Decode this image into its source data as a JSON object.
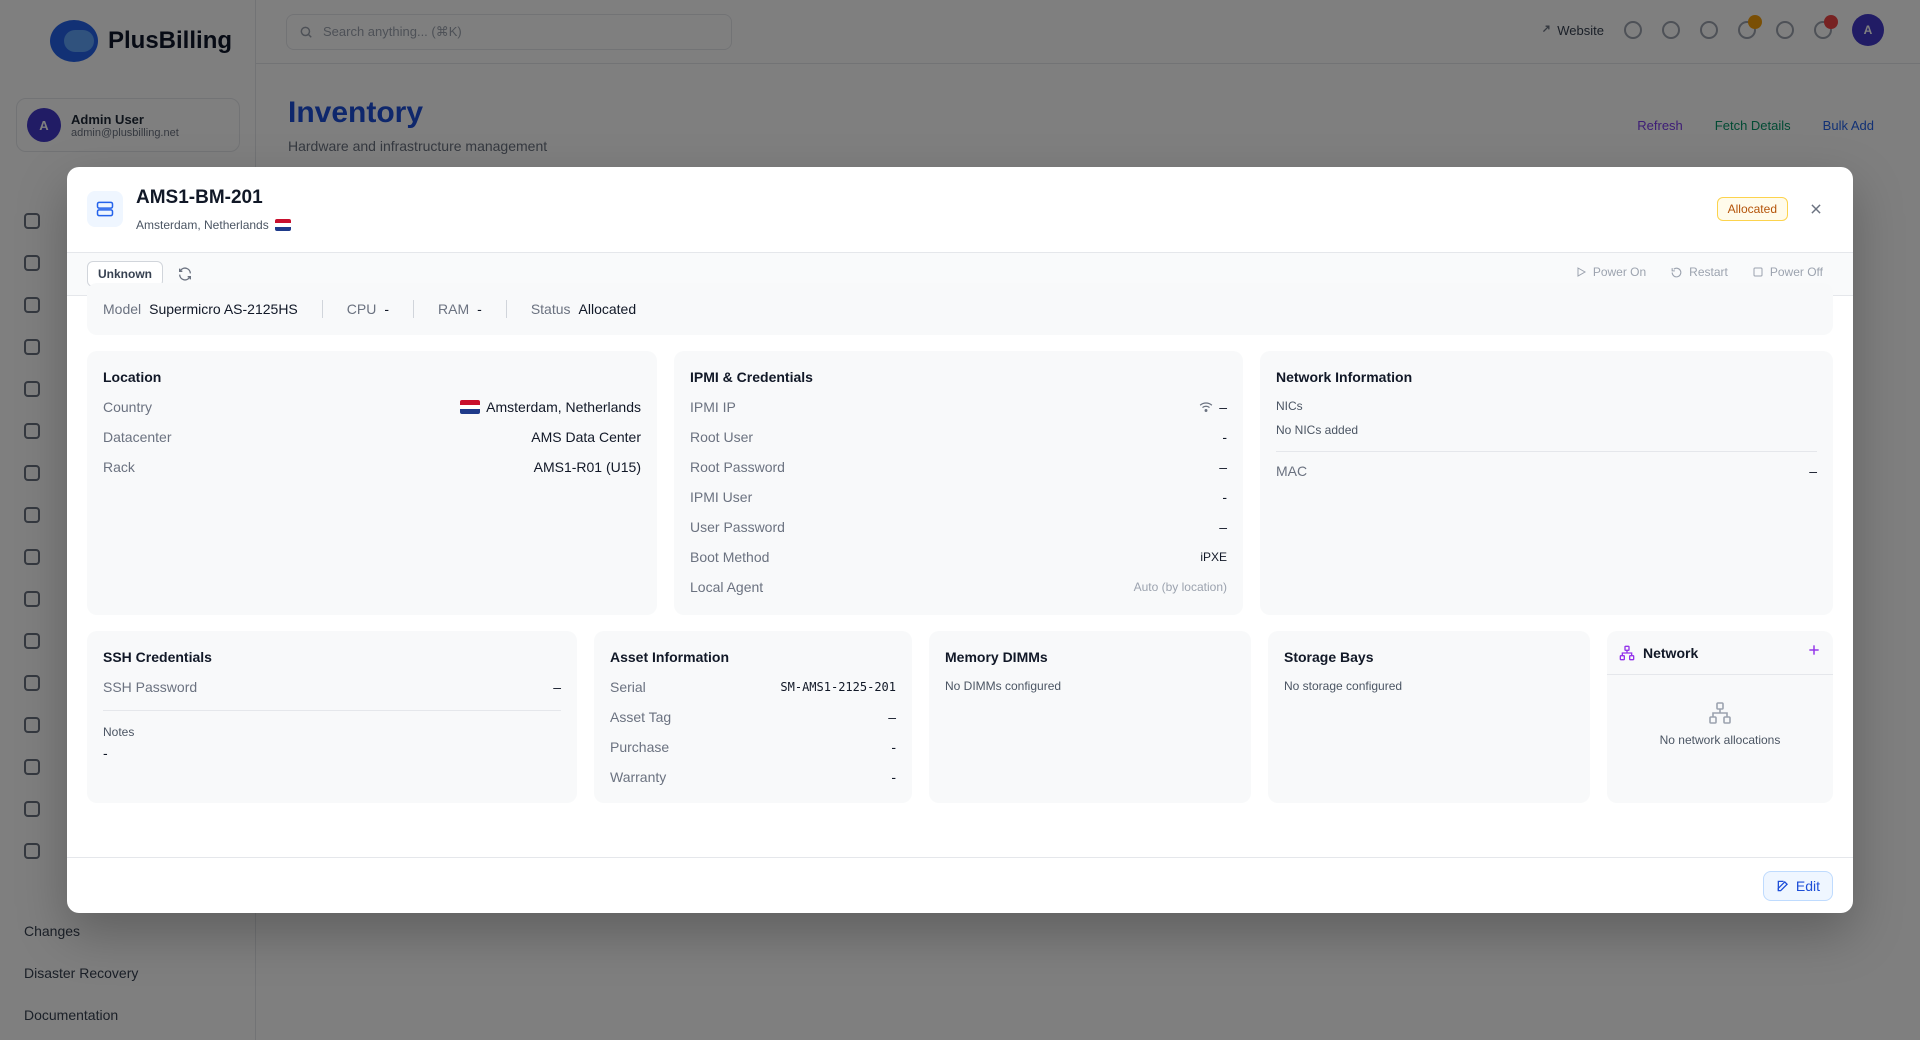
{
  "app": {
    "brand": "PlusBilling",
    "user": {
      "name": "Admin User",
      "email": "admin@plusbilling.net",
      "initial": "A"
    },
    "search_placeholder": "Search anything... (⌘K)",
    "website_label": "Website",
    "topbar_avatar_initial": "A",
    "page_title": "Inventory",
    "page_subtitle": "Hardware and infrastructure management",
    "page_actions": [
      "Refresh",
      "Fetch Details",
      "Bulk Add"
    ],
    "nav_bottom": [
      "Changes",
      "Disaster Recovery",
      "Documentation"
    ]
  },
  "modal": {
    "title": "AMS1-BM-201",
    "location": "Amsterdam, Netherlands",
    "status_badge": "Allocated",
    "power_state": "Unknown",
    "power_actions": [
      "Power On",
      "Restart",
      "Power Off"
    ],
    "summary": [
      {
        "key": "Model",
        "value": "Supermicro AS-2125HS"
      },
      {
        "key": "CPU",
        "value": "-"
      },
      {
        "key": "RAM",
        "value": "-"
      },
      {
        "key": "Status",
        "value": "Allocated"
      }
    ],
    "location_card": {
      "title": "Location",
      "rows": [
        {
          "key": "Country",
          "value": "Amsterdam, Netherlands"
        },
        {
          "key": "Datacenter",
          "value": "AMS Data Center"
        },
        {
          "key": "Rack",
          "value": "AMS1-R01 (U15)"
        }
      ]
    },
    "ipmi_card": {
      "title": "IPMI & Credentials",
      "rows": [
        {
          "key": "IPMI IP",
          "value": "–"
        },
        {
          "key": "Root User",
          "value": "-"
        },
        {
          "key": "Root Password",
          "value": "–"
        },
        {
          "key": "IPMI User",
          "value": "-"
        },
        {
          "key": "User Password",
          "value": "–"
        },
        {
          "key": "Boot Method",
          "value": "iPXE"
        },
        {
          "key": "Local Agent",
          "value": "Auto (by location)"
        }
      ]
    },
    "network_info_card": {
      "title": "Network Information",
      "nics_label": "NICs",
      "nics_empty": "No NICs added",
      "mac_key": "MAC",
      "mac_value": "–"
    },
    "ssh_card": {
      "title": "SSH Credentials",
      "password_key": "SSH Password",
      "password_value": "–",
      "notes_label": "Notes",
      "notes_value": "-"
    },
    "asset_card": {
      "title": "Asset Information",
      "rows": [
        {
          "key": "Serial",
          "value": "SM-AMS1-2125-201"
        },
        {
          "key": "Asset Tag",
          "value": "–"
        },
        {
          "key": "Purchase",
          "value": "-"
        },
        {
          "key": "Warranty",
          "value": "-"
        }
      ]
    },
    "memory_card": {
      "title": "Memory DIMMs",
      "empty": "No DIMMs configured"
    },
    "storage_card": {
      "title": "Storage Bays",
      "empty": "No storage configured"
    },
    "network_card": {
      "title": "Network",
      "empty": "No network allocations"
    },
    "edit_label": "Edit"
  },
  "colors": {
    "accent": "#1d4ed8",
    "allocated_badge": "#b45309",
    "network_accent": "#9333ea",
    "overlay": "rgba(0,0,0,0.5)"
  }
}
